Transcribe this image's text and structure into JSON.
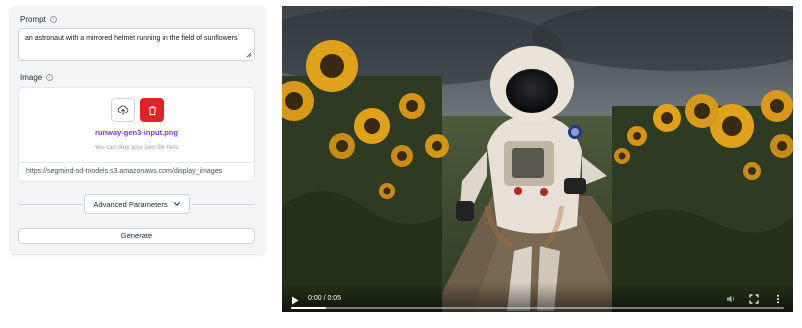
{
  "form": {
    "prompt": {
      "label": "Prompt",
      "value": "an astronaut with a mirrored helmet running in the field of sunflowers"
    },
    "image": {
      "label": "Image",
      "file_name": "runway-gen3-input.png",
      "drop_hint": "You can drop your own file here",
      "url": "https://segmind-sd-models.s3.amazonaws.com/display_images"
    },
    "advanced_label": "Advanced Parameters",
    "generate_label": "Generate"
  },
  "video": {
    "time_display": "0:00 / 0:05",
    "progress_fraction": 0.0
  },
  "icons": {
    "info": "info-icon",
    "upload": "upload-cloud-icon",
    "delete": "trash-icon",
    "chevron": "chevron-down-icon",
    "play": "play-icon",
    "volume": "volume-icon",
    "fullscreen": "fullscreen-icon",
    "more": "more-vertical-icon"
  },
  "colors": {
    "delete_button": "#dc2626",
    "file_name": "#7c3aed"
  }
}
